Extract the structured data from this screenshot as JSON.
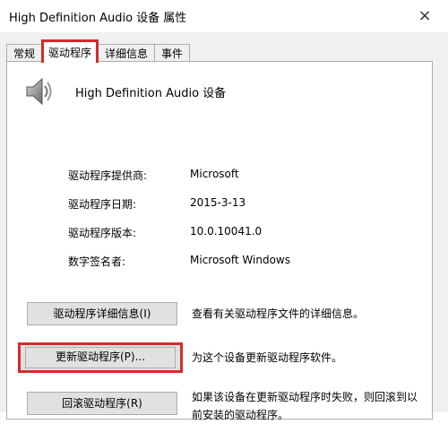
{
  "window": {
    "title": "High Definition Audio 设备 属性",
    "close_symbol": "×"
  },
  "tabs": [
    {
      "label": "常规"
    },
    {
      "label": "驱动程序"
    },
    {
      "label": "详细信息"
    },
    {
      "label": "事件"
    }
  ],
  "device": {
    "name": "High Definition Audio 设备",
    "icon": "speaker-icon"
  },
  "properties": [
    {
      "label": "驱动程序提供商:",
      "value": "Microsoft"
    },
    {
      "label": "驱动程序日期:",
      "value": "2015-3-13"
    },
    {
      "label": "驱动程序版本:",
      "value": "10.0.10041.0"
    },
    {
      "label": "数字签名者:",
      "value": "Microsoft Windows"
    }
  ],
  "actions": [
    {
      "button": "驱动程序详细信息(I)",
      "description": "查看有关驱动程序文件的详细信息。"
    },
    {
      "button": "更新驱动程序(P)...",
      "description": "为这个设备更新驱动程序软件。"
    },
    {
      "button": "回滚驱动程序(R)",
      "description": "如果该设备在更新驱动程序时失败，则回滚到以前安装的驱动程序。"
    }
  ],
  "colors": {
    "highlight": "#d52b2b",
    "dialog_background": "#f0f0f0",
    "button_face": "#e1e1e1"
  }
}
